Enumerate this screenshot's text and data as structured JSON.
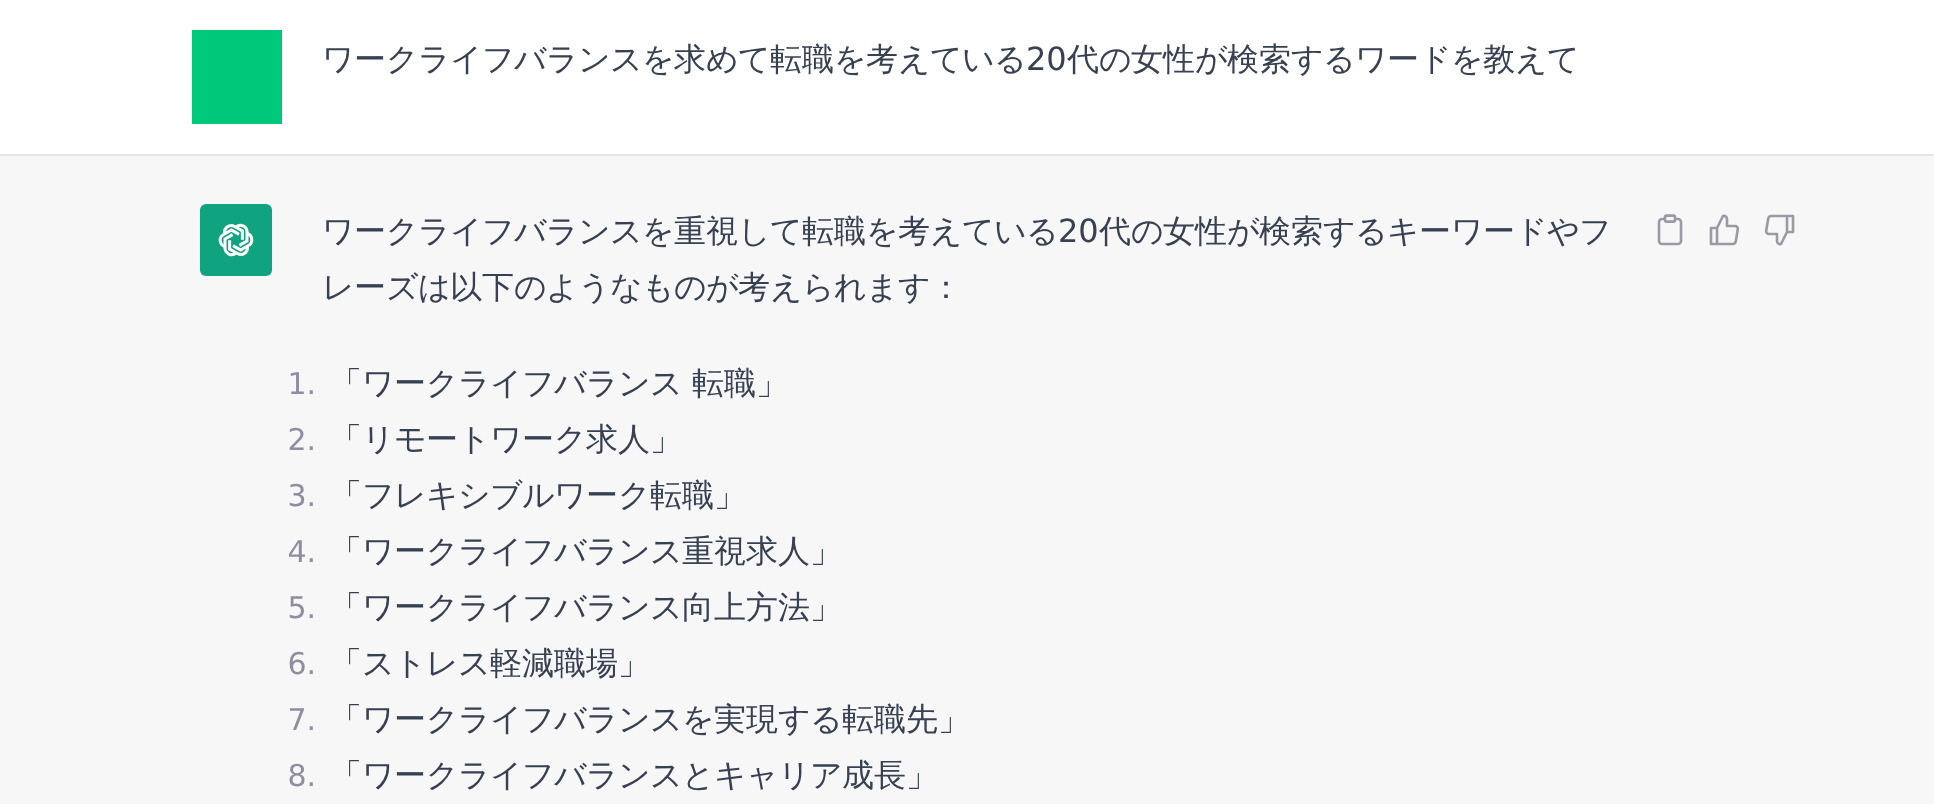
{
  "user_message": {
    "text": "ワークライフバランスを求めて転職を考えている20代の女性が検索するワードを教えて"
  },
  "assistant_message": {
    "intro": "ワークライフバランスを重視して転職を考えている20代の女性が検索するキーワードやフレーズは以下のようなものが考えられます：",
    "list": [
      {
        "number": "1.",
        "text": "「ワークライフバランス 転職」"
      },
      {
        "number": "2.",
        "text": "「リモートワーク求人」"
      },
      {
        "number": "3.",
        "text": "「フレキシブルワーク転職」"
      },
      {
        "number": "4.",
        "text": "「ワークライフバランス重視求人」"
      },
      {
        "number": "5.",
        "text": "「ワークライフバランス向上方法」"
      },
      {
        "number": "6.",
        "text": "「ストレス軽減職場」"
      },
      {
        "number": "7.",
        "text": "「ワークライフバランスを実現する転職先」"
      },
      {
        "number": "8.",
        "text": "「ワークライフバランスとキャリア成長」"
      }
    ]
  }
}
